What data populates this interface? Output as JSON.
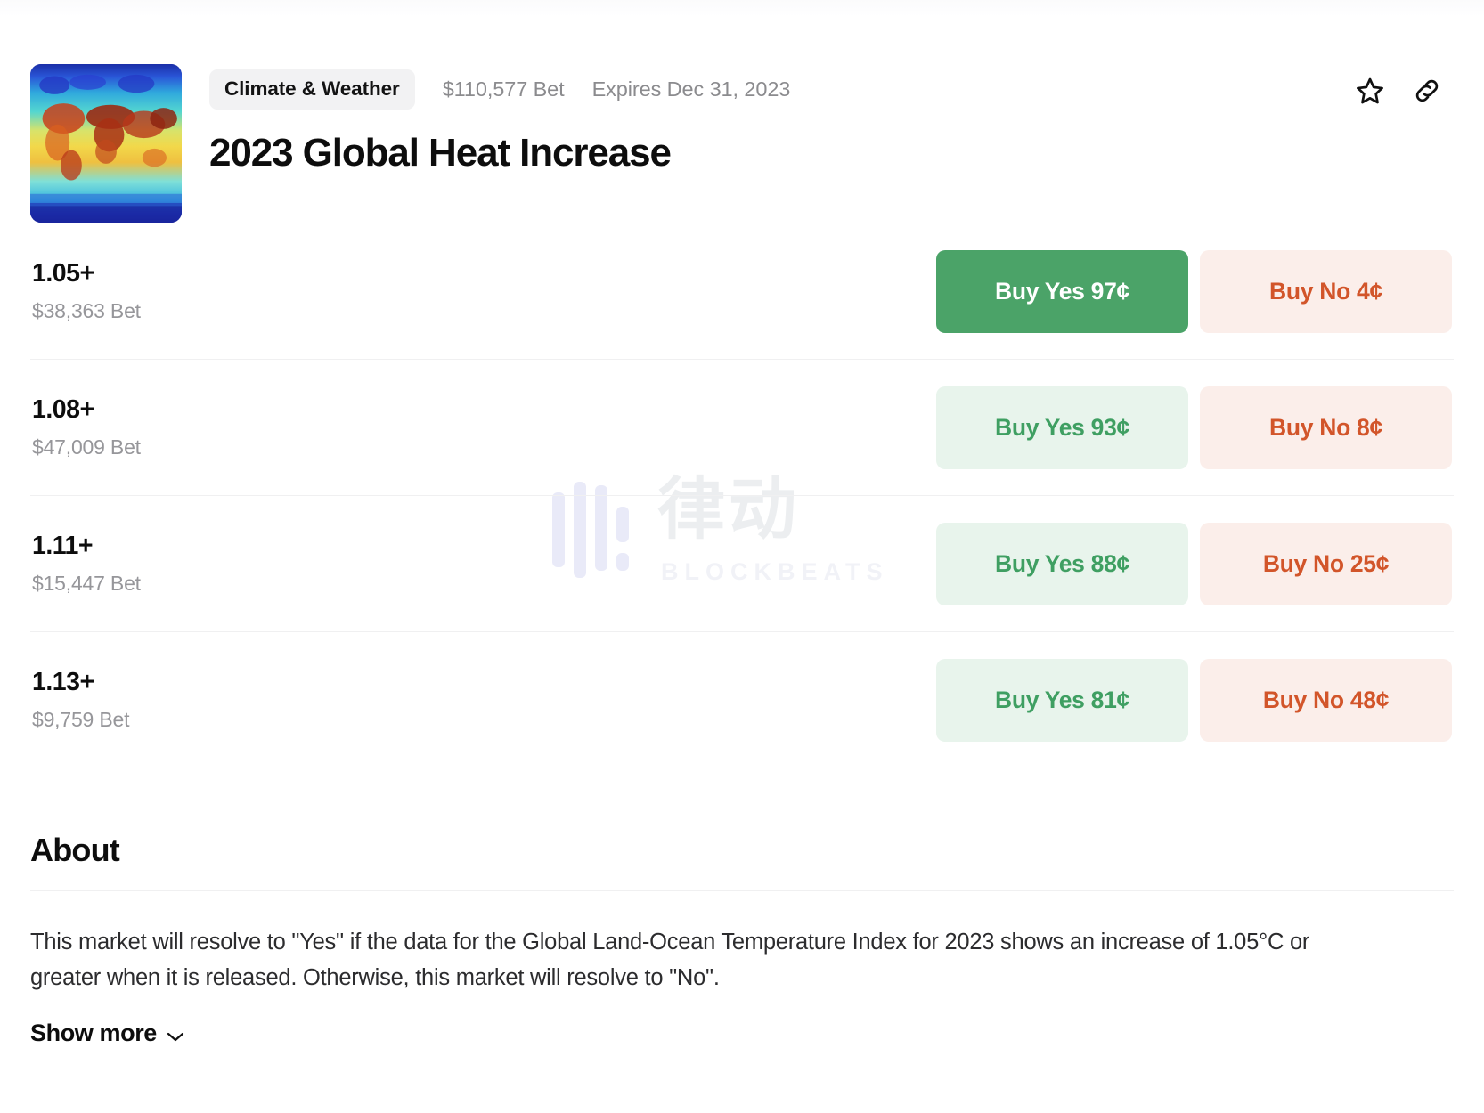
{
  "header": {
    "thumbnail_alt": "global-temperature-map",
    "category_chip": "Climate & Weather",
    "volume": "$110,577 Bet",
    "expiry": "Expires Dec 31, 2023",
    "title": "2023 Global Heat Increase",
    "bookmark_icon": "star-icon",
    "share_icon": "link-icon"
  },
  "outcomes": [
    {
      "name": "1.05+",
      "volume": "$38,363 Bet",
      "yes_label": "Buy Yes 97¢",
      "no_label": "Buy No 4¢",
      "yes_selected": true,
      "no_selected": false
    },
    {
      "name": "1.08+",
      "volume": "$47,009 Bet",
      "yes_label": "Buy Yes 93¢",
      "no_label": "Buy No 8¢",
      "yes_selected": false,
      "no_selected": false
    },
    {
      "name": "1.11+",
      "volume": "$15,447 Bet",
      "yes_label": "Buy Yes 88¢",
      "no_label": "Buy No 25¢",
      "yes_selected": false,
      "no_selected": false
    },
    {
      "name": "1.13+",
      "volume": "$9,759 Bet",
      "yes_label": "Buy Yes 81¢",
      "no_label": "Buy No 48¢",
      "yes_selected": false,
      "no_selected": false
    }
  ],
  "about": {
    "heading": "About",
    "body": "This market will resolve to \"Yes\" if the data for the Global Land-Ocean Temperature Index for 2023 shows an increase of 1.05°C or greater when it is released. Otherwise, this market will resolve to \"No\".",
    "show_more_label": "Show more",
    "chevron_icon": "chevron-down-icon"
  },
  "watermark": {
    "chinese": "律动",
    "brand": "BLOCKBEATS"
  },
  "colors": {
    "yes_accent": "#4ba368",
    "yes_tint": "#e8f4ec",
    "no_accent": "#d2552a",
    "no_tint": "#fbeeea",
    "muted_text": "#96969a",
    "chip_bg": "#f2f2f3"
  }
}
